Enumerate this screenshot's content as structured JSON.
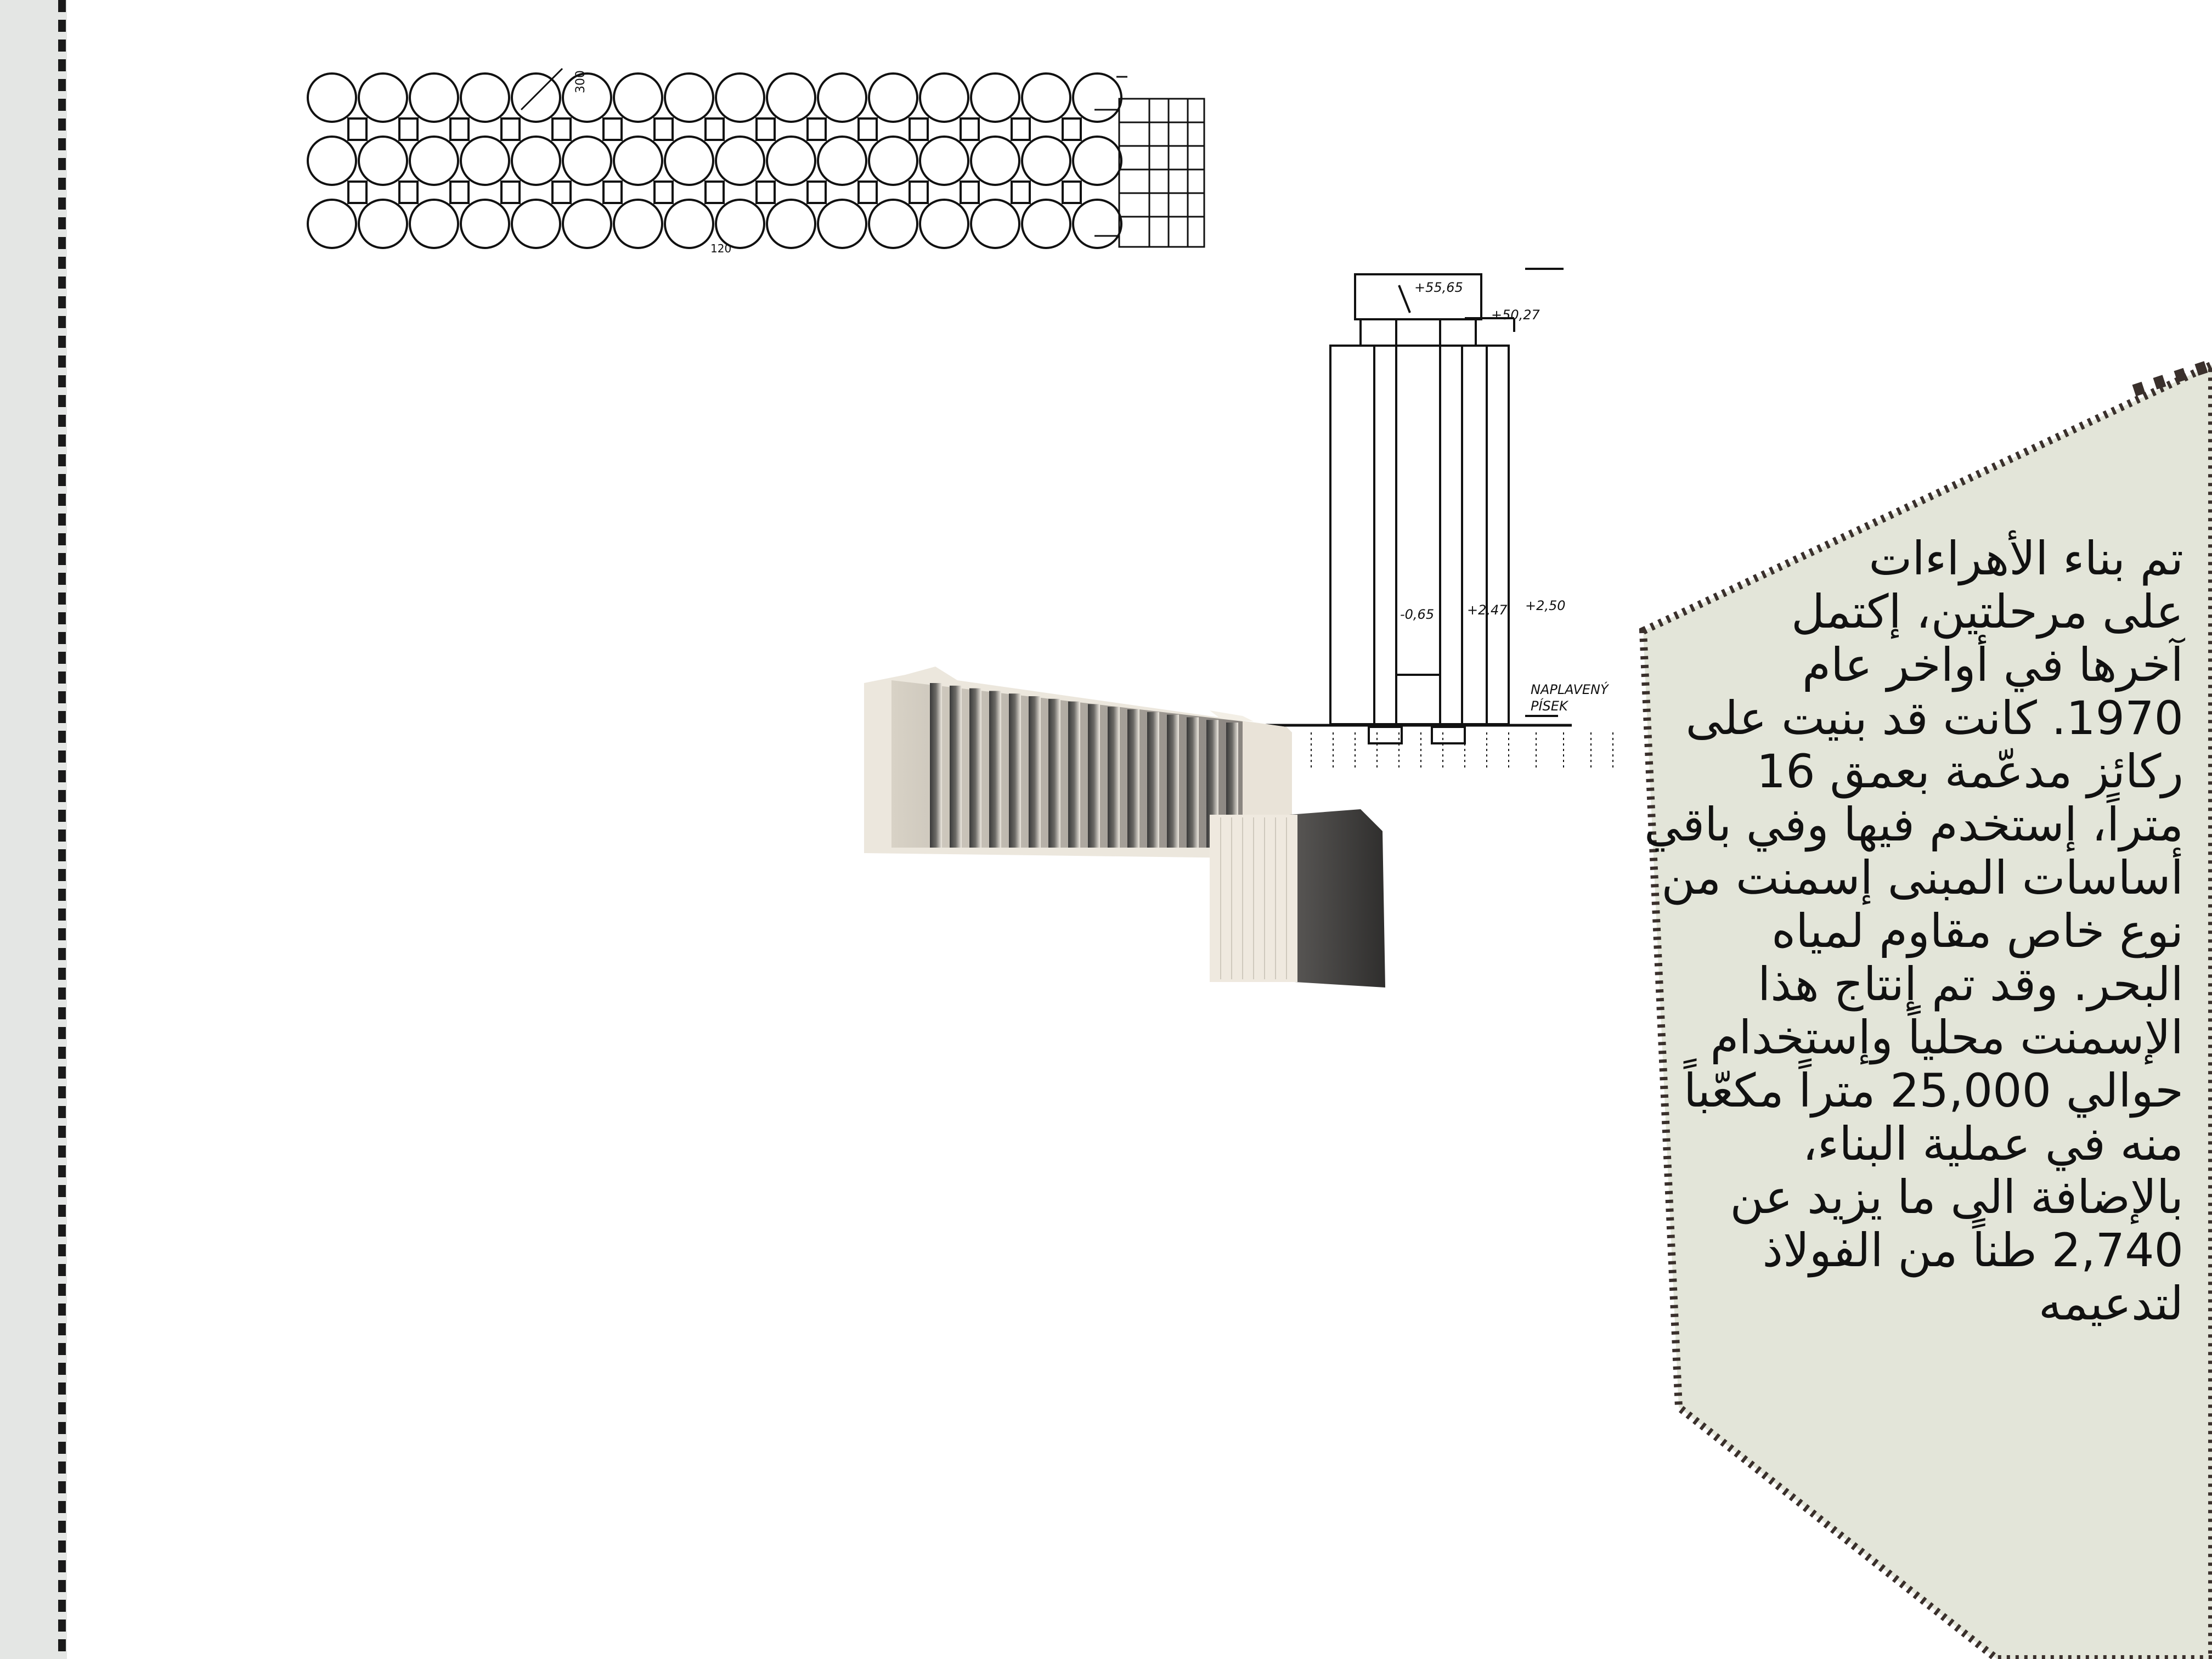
{
  "colors": {
    "panel_fill": "#e3e5d9",
    "panel_border": "#3a302c",
    "left_strip": "#e4e6e4",
    "line_art": "#111111"
  },
  "plan_drawing": {
    "dimension_label": "300",
    "bottom_label": "120"
  },
  "section_drawing": {
    "elev_top": "+55,65",
    "elev_roof": "+50,27",
    "elev_base_1": "-0,65",
    "elev_base_2": "+2,47",
    "elev_ground": "+2,50",
    "soil_label_1": "NAPLAVENÝ",
    "soil_label_2": "PÍSEK"
  },
  "info": {
    "lines": [
      "تم بناء الأهراءات",
      "على مرحلتين، إكتمل",
      "آخرها في أواخر عام",
      "1970. كانت قد بنيت على",
      "ركائز مدعّمة بعمق 16",
      "متراً، إستخدم فيها وفي باقي",
      "أساسات المبنى إسمنت من",
      "نوع خاص مقاوم لمياه",
      "البحر. وقد تم إنتاج هذا",
      "الإسمنت محلياً وإستخدام",
      "حوالي 25,000 متراً مكعّباً",
      "منه في عملية البناء،",
      "بالإضافة الى ما يزيد عن",
      "2,740 طناً من الفولاذ",
      "لتدعيمه"
    ]
  }
}
